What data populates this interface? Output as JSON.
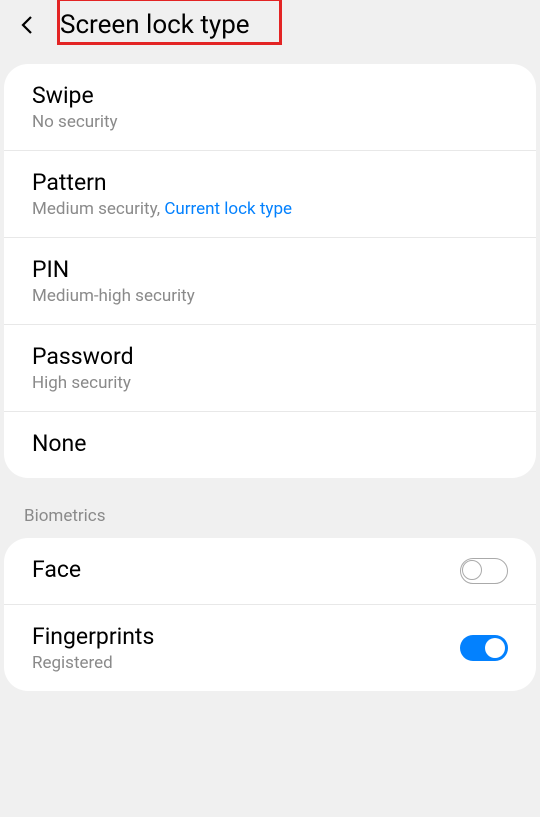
{
  "header": {
    "title": "Screen lock type"
  },
  "lockTypes": [
    {
      "title": "Swipe",
      "subtitle": "No security",
      "link": ""
    },
    {
      "title": "Pattern",
      "subtitle": "Medium security, ",
      "link": "Current lock type"
    },
    {
      "title": "PIN",
      "subtitle": "Medium-high security",
      "link": ""
    },
    {
      "title": "Password",
      "subtitle": "High security",
      "link": ""
    },
    {
      "title": "None",
      "subtitle": "",
      "link": ""
    }
  ],
  "biometricsHeader": "Biometrics",
  "biometrics": [
    {
      "title": "Face",
      "subtitle": "",
      "enabled": false
    },
    {
      "title": "Fingerprints",
      "subtitle": "Registered",
      "enabled": true
    }
  ]
}
